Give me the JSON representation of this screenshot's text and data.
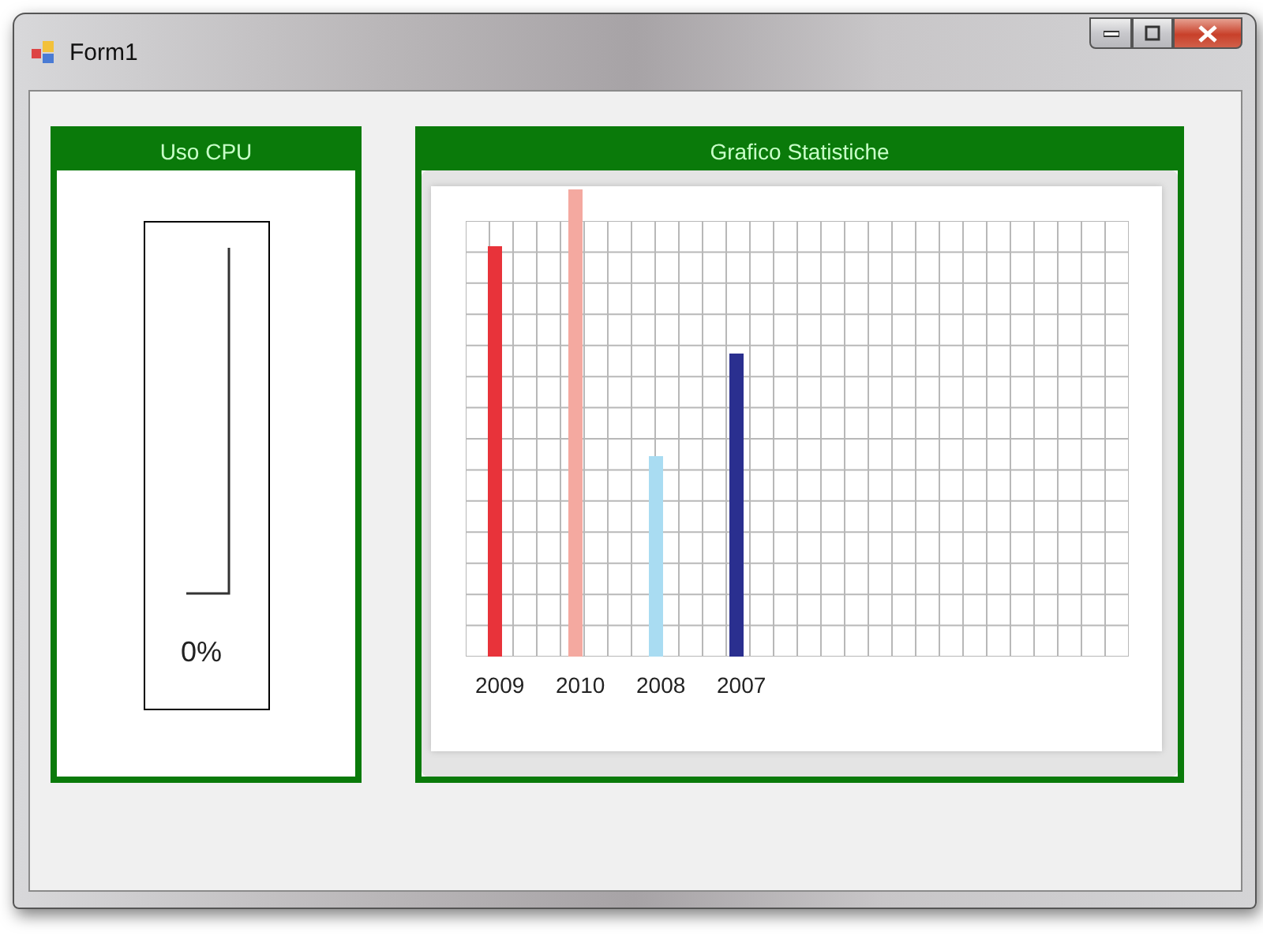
{
  "window": {
    "title": "Form1"
  },
  "cpu_panel": {
    "title": "Uso CPU",
    "reading": "0%"
  },
  "chart_panel": {
    "title": "Grafico Statistiche",
    "bars": [
      {
        "label": "2009",
        "color": "#e8333a"
      },
      {
        "label": "2010",
        "color": "#f4a9a0"
      },
      {
        "label": "2008",
        "color": "#a9dcf2"
      },
      {
        "label": "2007",
        "color": "#2a2f8f"
      }
    ]
  }
}
